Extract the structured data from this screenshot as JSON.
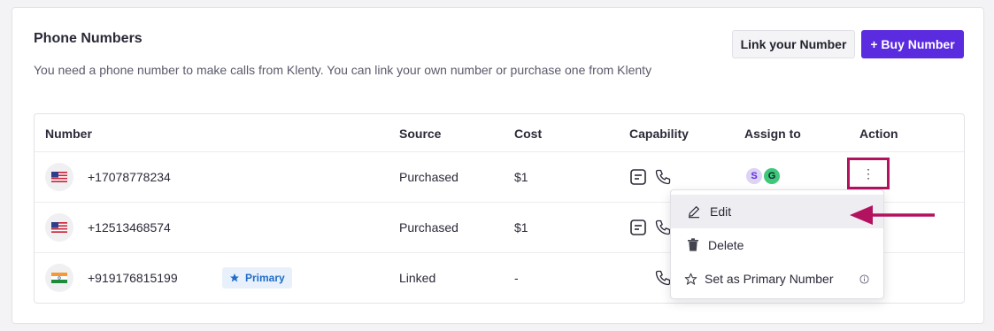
{
  "header": {
    "title": "Phone Numbers",
    "subtitle": "You need a phone number to make calls from Klenty. You can link your own number or purchase one from Klenty",
    "link_button": "Link your Number",
    "buy_button": "+ Buy Number"
  },
  "table": {
    "columns": [
      "Number",
      "Source",
      "Cost",
      "Capability",
      "Assign to",
      "Action"
    ],
    "rows": [
      {
        "number": "+17078778234",
        "country": "US",
        "source": "Purchased",
        "cost": "$1",
        "capabilities": [
          "sms",
          "call"
        ],
        "assignees": [
          "S",
          "G"
        ],
        "primary": ""
      },
      {
        "number": "+12513468574",
        "country": "US",
        "source": "Purchased",
        "cost": "$1",
        "capabilities": [
          "sms",
          "call"
        ],
        "assignees": [],
        "primary": ""
      },
      {
        "number": "+919176815199",
        "country": "IN",
        "source": "Linked",
        "cost": "-",
        "capabilities": [
          "call"
        ],
        "assignees": [],
        "primary": "Primary"
      }
    ],
    "action_icon": "⋮"
  },
  "menu": {
    "items": [
      {
        "label": "Edit",
        "icon": "pencil-icon"
      },
      {
        "label": "Delete",
        "icon": "trash-icon"
      },
      {
        "label": "Set as Primary Number",
        "icon": "star-icon"
      }
    ]
  },
  "colors": {
    "primary": "#5b2be0",
    "highlight": "#b3125e",
    "badge_text": "#1f6cc8"
  }
}
